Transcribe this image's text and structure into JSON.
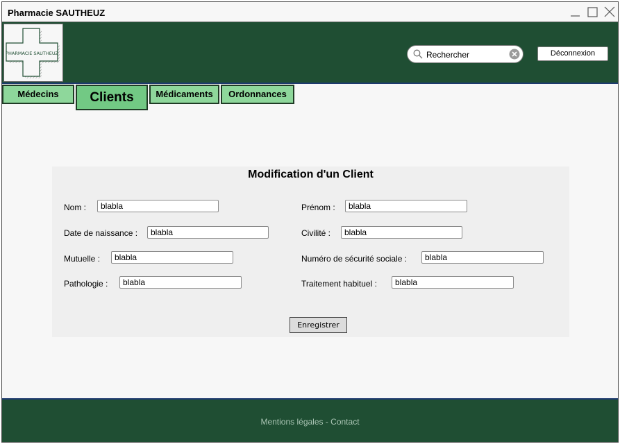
{
  "window": {
    "title": "Pharmacie SAUTHEUZ"
  },
  "logo": {
    "text": "PHARMACIE SAUTHEUZ",
    "icon": "pharmacy-cross-icon"
  },
  "header": {
    "search_value": "Rechercher",
    "logout_label": "Déconnexion"
  },
  "tabs": [
    {
      "label": "Médecins",
      "active": false
    },
    {
      "label": "Clients",
      "active": true
    },
    {
      "label": "Médicaments",
      "active": false
    },
    {
      "label": "Ordonnances",
      "active": false
    }
  ],
  "form": {
    "title": "Modification d'un Client",
    "fields": {
      "nom": {
        "label": "Nom :",
        "value": "blabla"
      },
      "prenom": {
        "label": "Prénom :",
        "value": "blabla"
      },
      "date_naissance": {
        "label": "Date de naissance :",
        "value": "blabla"
      },
      "civilite": {
        "label": "Civilité :",
        "value": "blabla"
      },
      "mutuelle": {
        "label": "Mutuelle :",
        "value": "blabla"
      },
      "num_secu": {
        "label": "Numéro de sécurité sociale :",
        "value": "blabla"
      },
      "pathologie": {
        "label": "Pathologie :",
        "value": "blabla"
      },
      "traitement": {
        "label": "Traitement habituel :",
        "value": "blabla"
      }
    },
    "save_label": "Enregistrer"
  },
  "footer": {
    "text": "Mentions légales - Contact"
  },
  "colors": {
    "header_bg": "#1f4e33",
    "tab_bg": "#8ed79b",
    "tab_active_bg": "#72c984",
    "footer_text": "#a9c4b3"
  }
}
